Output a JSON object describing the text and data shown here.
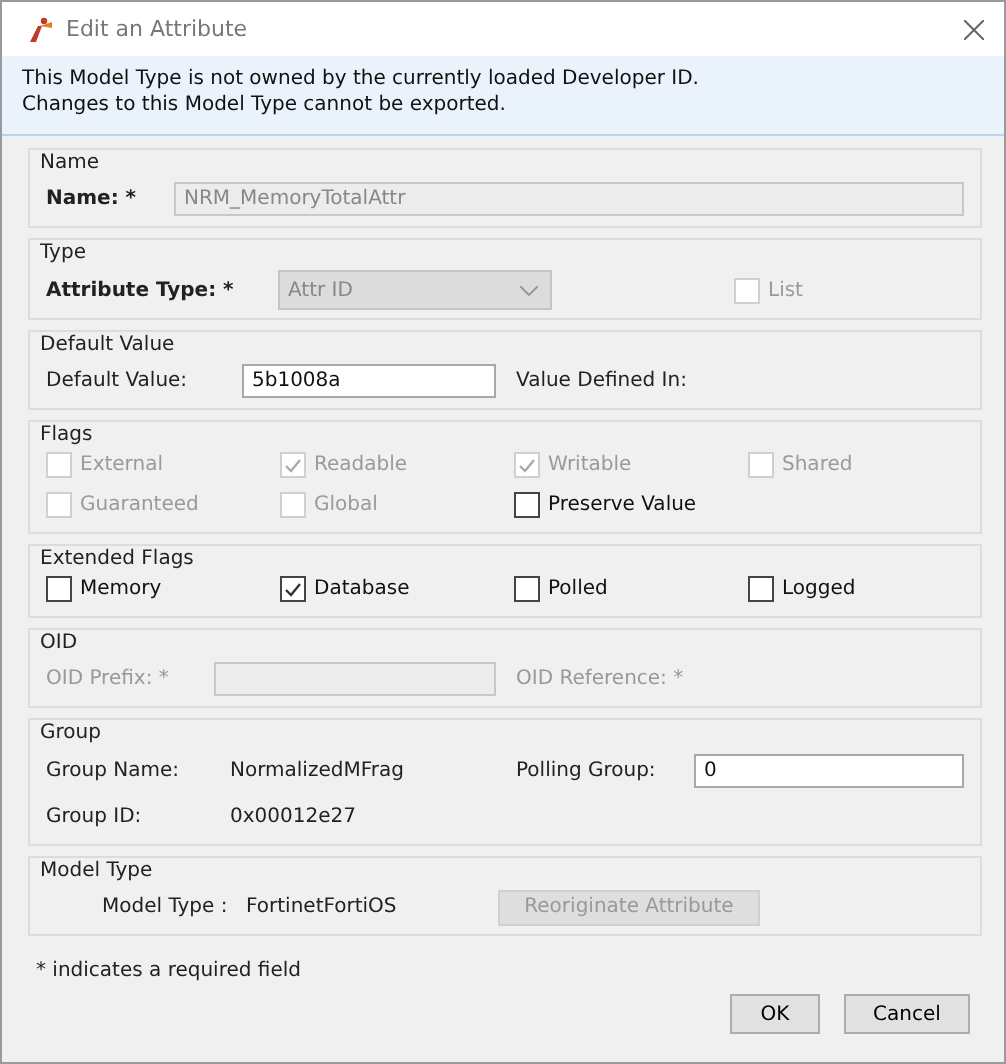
{
  "window": {
    "title": "Edit an Attribute"
  },
  "notice": [
    "This Model Type is not owned by the currently loaded Developer ID.",
    "Changes to this Model Type cannot be exported."
  ],
  "name_group": {
    "legend": "Name",
    "label": "Name: *",
    "value": "NRM_MemoryTotalAttr",
    "disabled": true
  },
  "type_group": {
    "legend": "Type",
    "label": "Attribute Type: *",
    "value": "Attr ID",
    "disabled": true,
    "list": {
      "label": "List",
      "checked": false,
      "disabled": true
    }
  },
  "default_value": {
    "legend": "Default Value",
    "label": "Default Value:",
    "value": "5b1008a",
    "defined_in_label": "Value Defined In:"
  },
  "flags": {
    "legend": "Flags",
    "items": [
      {
        "label": "External",
        "checked": false,
        "disabled": true
      },
      {
        "label": "Readable",
        "checked": true,
        "disabled": true
      },
      {
        "label": "Writable",
        "checked": true,
        "disabled": true
      },
      {
        "label": "Shared",
        "checked": false,
        "disabled": true
      },
      {
        "label": "Guaranteed",
        "checked": false,
        "disabled": true
      },
      {
        "label": "Global",
        "checked": false,
        "disabled": true
      },
      {
        "label": "Preserve Value",
        "checked": false,
        "disabled": false
      }
    ]
  },
  "extended_flags": {
    "legend": "Extended Flags",
    "items": [
      {
        "label": "Memory",
        "checked": false,
        "disabled": false
      },
      {
        "label": "Database",
        "checked": true,
        "disabled": false
      },
      {
        "label": "Polled",
        "checked": false,
        "disabled": false
      },
      {
        "label": "Logged",
        "checked": false,
        "disabled": false
      }
    ]
  },
  "oid": {
    "legend": "OID",
    "prefix_label": "OID Prefix: *",
    "reference_label": "OID Reference: *",
    "disabled": true
  },
  "group": {
    "legend": "Group",
    "name_label": "Group Name:",
    "name_value": "NormalizedMFrag",
    "polling_label": "Polling Group:",
    "polling_value": "0",
    "id_label": "Group ID:",
    "id_value": "0x00012e27"
  },
  "model_type": {
    "legend": "Model Type",
    "label": "Model Type :",
    "value": "FortinetFortiOS",
    "button": {
      "label": "Reoriginate Attribute",
      "disabled": true
    }
  },
  "footnote": "* indicates a required field",
  "buttons": [
    {
      "label": "OK"
    },
    {
      "label": "Cancel"
    }
  ]
}
